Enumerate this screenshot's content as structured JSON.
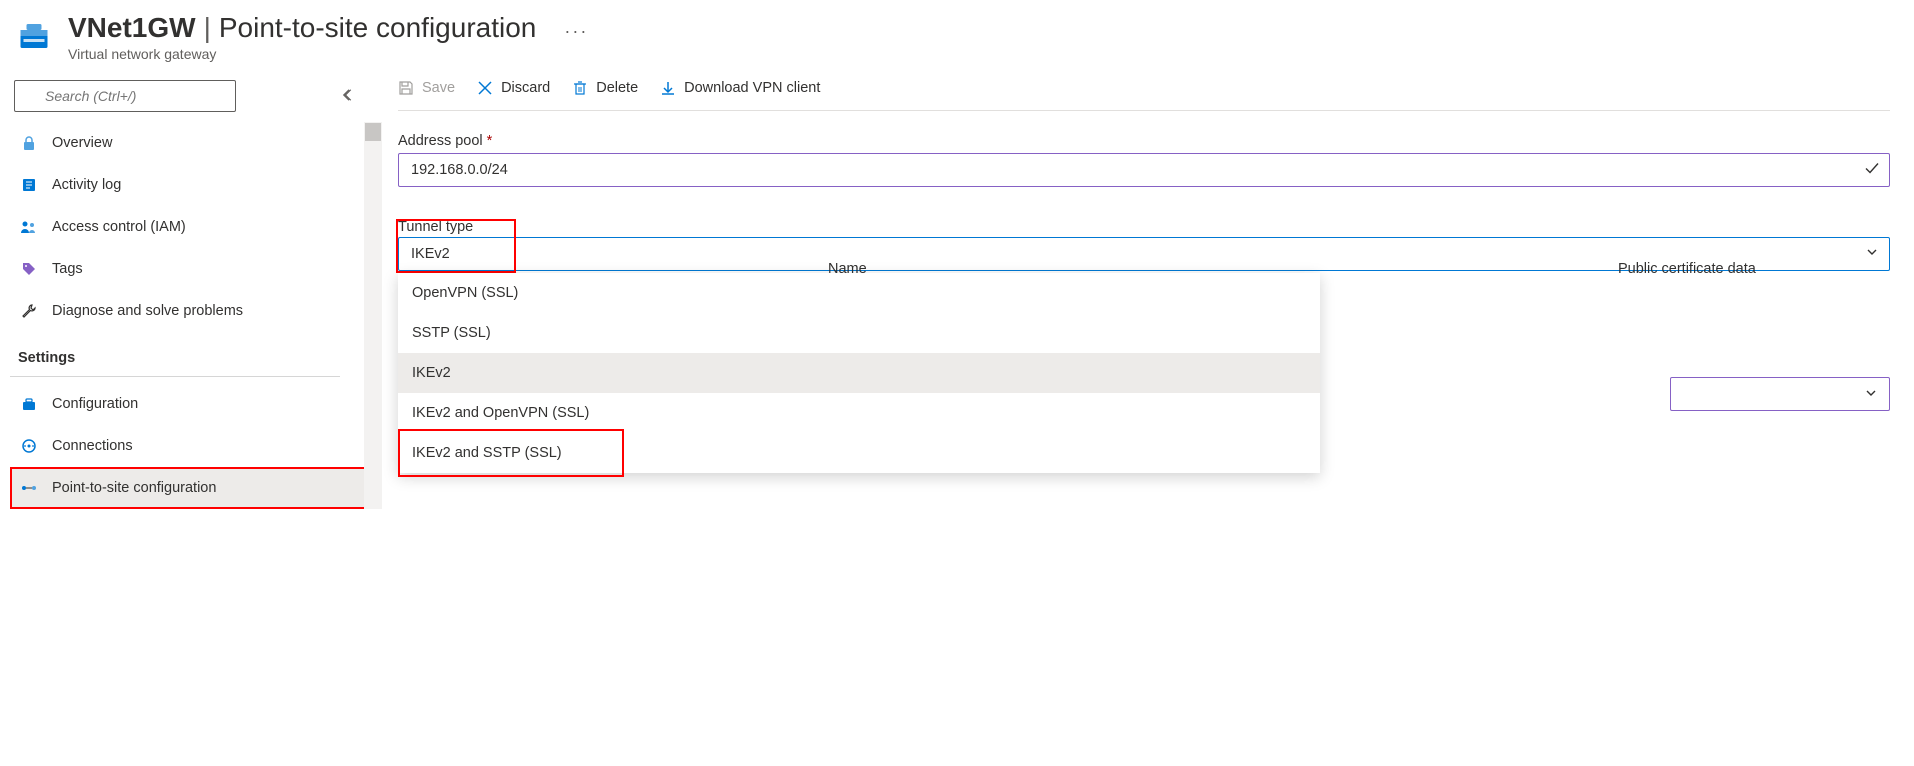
{
  "header": {
    "resource_name": "VNet1GW",
    "page_title": "Point-to-site configuration",
    "resource_type": "Virtual network gateway"
  },
  "search": {
    "placeholder": "Search (Ctrl+/)"
  },
  "nav": {
    "overview": "Overview",
    "activity_log": "Activity log",
    "access_control": "Access control (IAM)",
    "tags": "Tags",
    "diagnose": "Diagnose and solve problems",
    "section_settings": "Settings",
    "configuration": "Configuration",
    "connections": "Connections",
    "p2s": "Point-to-site configuration"
  },
  "toolbar": {
    "save": "Save",
    "discard": "Discard",
    "delete": "Delete",
    "download": "Download VPN client"
  },
  "form": {
    "address_pool_label": "Address pool",
    "address_pool_value": "192.168.0.0/24",
    "tunnel_type_label": "Tunnel type",
    "tunnel_type_value": "IKEv2",
    "tunnel_options": {
      "openvpn": "OpenVPN (SSL)",
      "sstp": "SSTP (SSL)",
      "ikev2": "IKEv2",
      "ikev2_openvpn": "IKEv2 and OpenVPN (SSL)",
      "ikev2_sstp": "IKEv2 and SSTP (SSL)"
    },
    "hidden_name": "Name",
    "hidden_cert": "Public certificate data"
  }
}
